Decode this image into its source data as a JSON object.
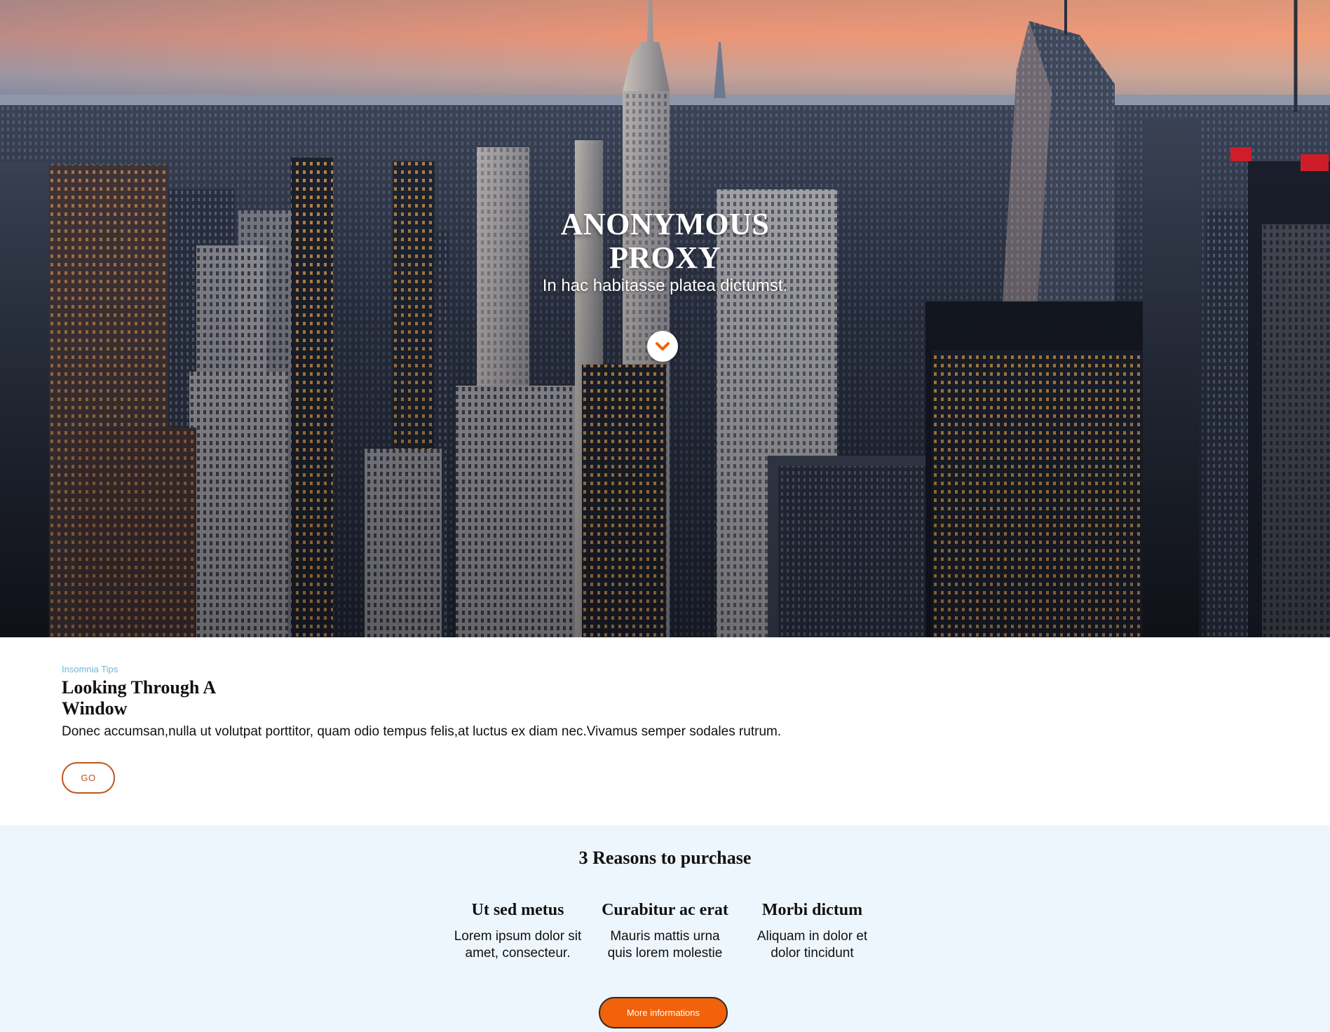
{
  "hero": {
    "title": "ANONYMOUS PROXY",
    "subtitle": "In hac habitasse platea dictumst.",
    "scroll_icon": "chevron-down-icon",
    "background_image": "city-skyline-at-sunset"
  },
  "article": {
    "category": "Insomnia Tips",
    "title": "Looking Through A Window",
    "text": "Donec accumsan,nulla ut volutpat porttitor, quam odio tempus felis,at luctus ex diam nec.Vivamus semper sodales rutrum.",
    "button_label": "GO"
  },
  "reasons": {
    "title": "3 Reasons to purchase",
    "items": [
      {
        "heading": "Ut sed metus",
        "text": "Lorem ipsum dolor sit amet, consecteur."
      },
      {
        "heading": "Curabitur ac erat",
        "text": "Mauris mattis urna quis lorem molestie"
      },
      {
        "heading": "Morbi dictum",
        "text": "Aliquam in dolor et dolor tincidunt"
      }
    ],
    "button_label": "More informations"
  },
  "colors": {
    "accent": "#f1620a",
    "go_border": "#c0541b",
    "category": "#6fb6d8",
    "reasons_bg": "#eef6fd"
  }
}
